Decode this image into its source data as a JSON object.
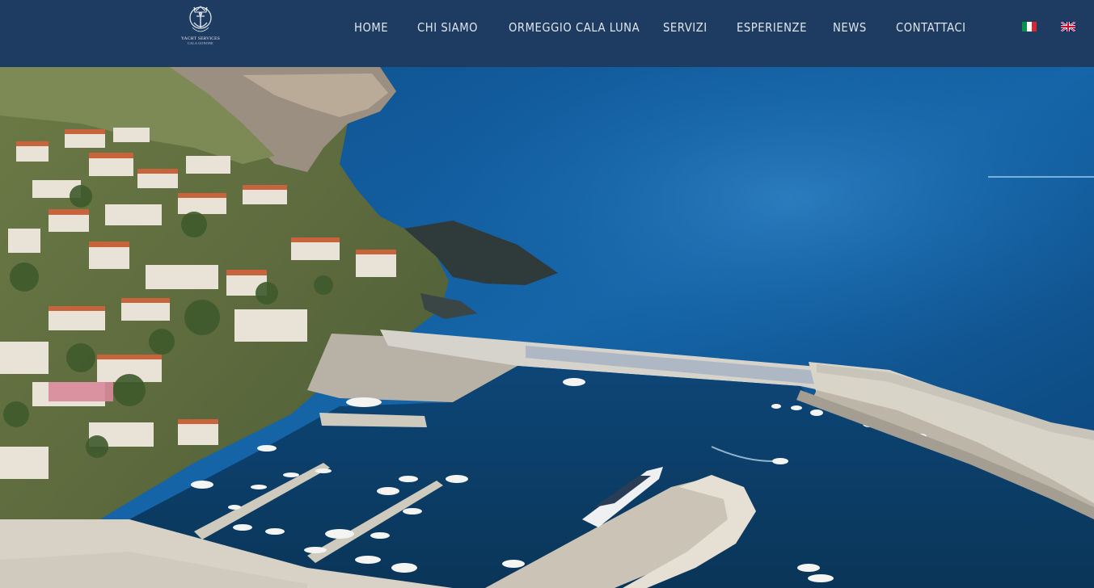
{
  "header": {
    "logo": {
      "emblem": "anchor-emblem",
      "text_lines": [
        "YACHT SERVICES",
        "CALA GONONE"
      ]
    },
    "nav": [
      {
        "label": "HOME",
        "name": "nav-home"
      },
      {
        "label": "CHI SIAMO",
        "name": "nav-chi-siamo"
      },
      {
        "label": "ORMEGGIO CALA LUNA",
        "name": "nav-ormeggio-cala-luna"
      },
      {
        "label": "SERVIZI",
        "name": "nav-servizi"
      },
      {
        "label": "ESPERIENZE",
        "name": "nav-esperienze"
      },
      {
        "label": "NEWS",
        "name": "nav-news"
      },
      {
        "label": "CONTATTACI",
        "name": "nav-contattaci"
      }
    ],
    "languages": [
      {
        "code": "it",
        "icon": "italy-flag-icon"
      },
      {
        "code": "en",
        "icon": "uk-flag-icon"
      }
    ]
  },
  "hero": {
    "image": "aerial view of coastal town and harbor"
  },
  "colors": {
    "header_bg": "#1e3b61",
    "nav_text": "#dfe6ee",
    "sea_deep": "#0f4a80",
    "sea_light": "#1d6fb3"
  }
}
